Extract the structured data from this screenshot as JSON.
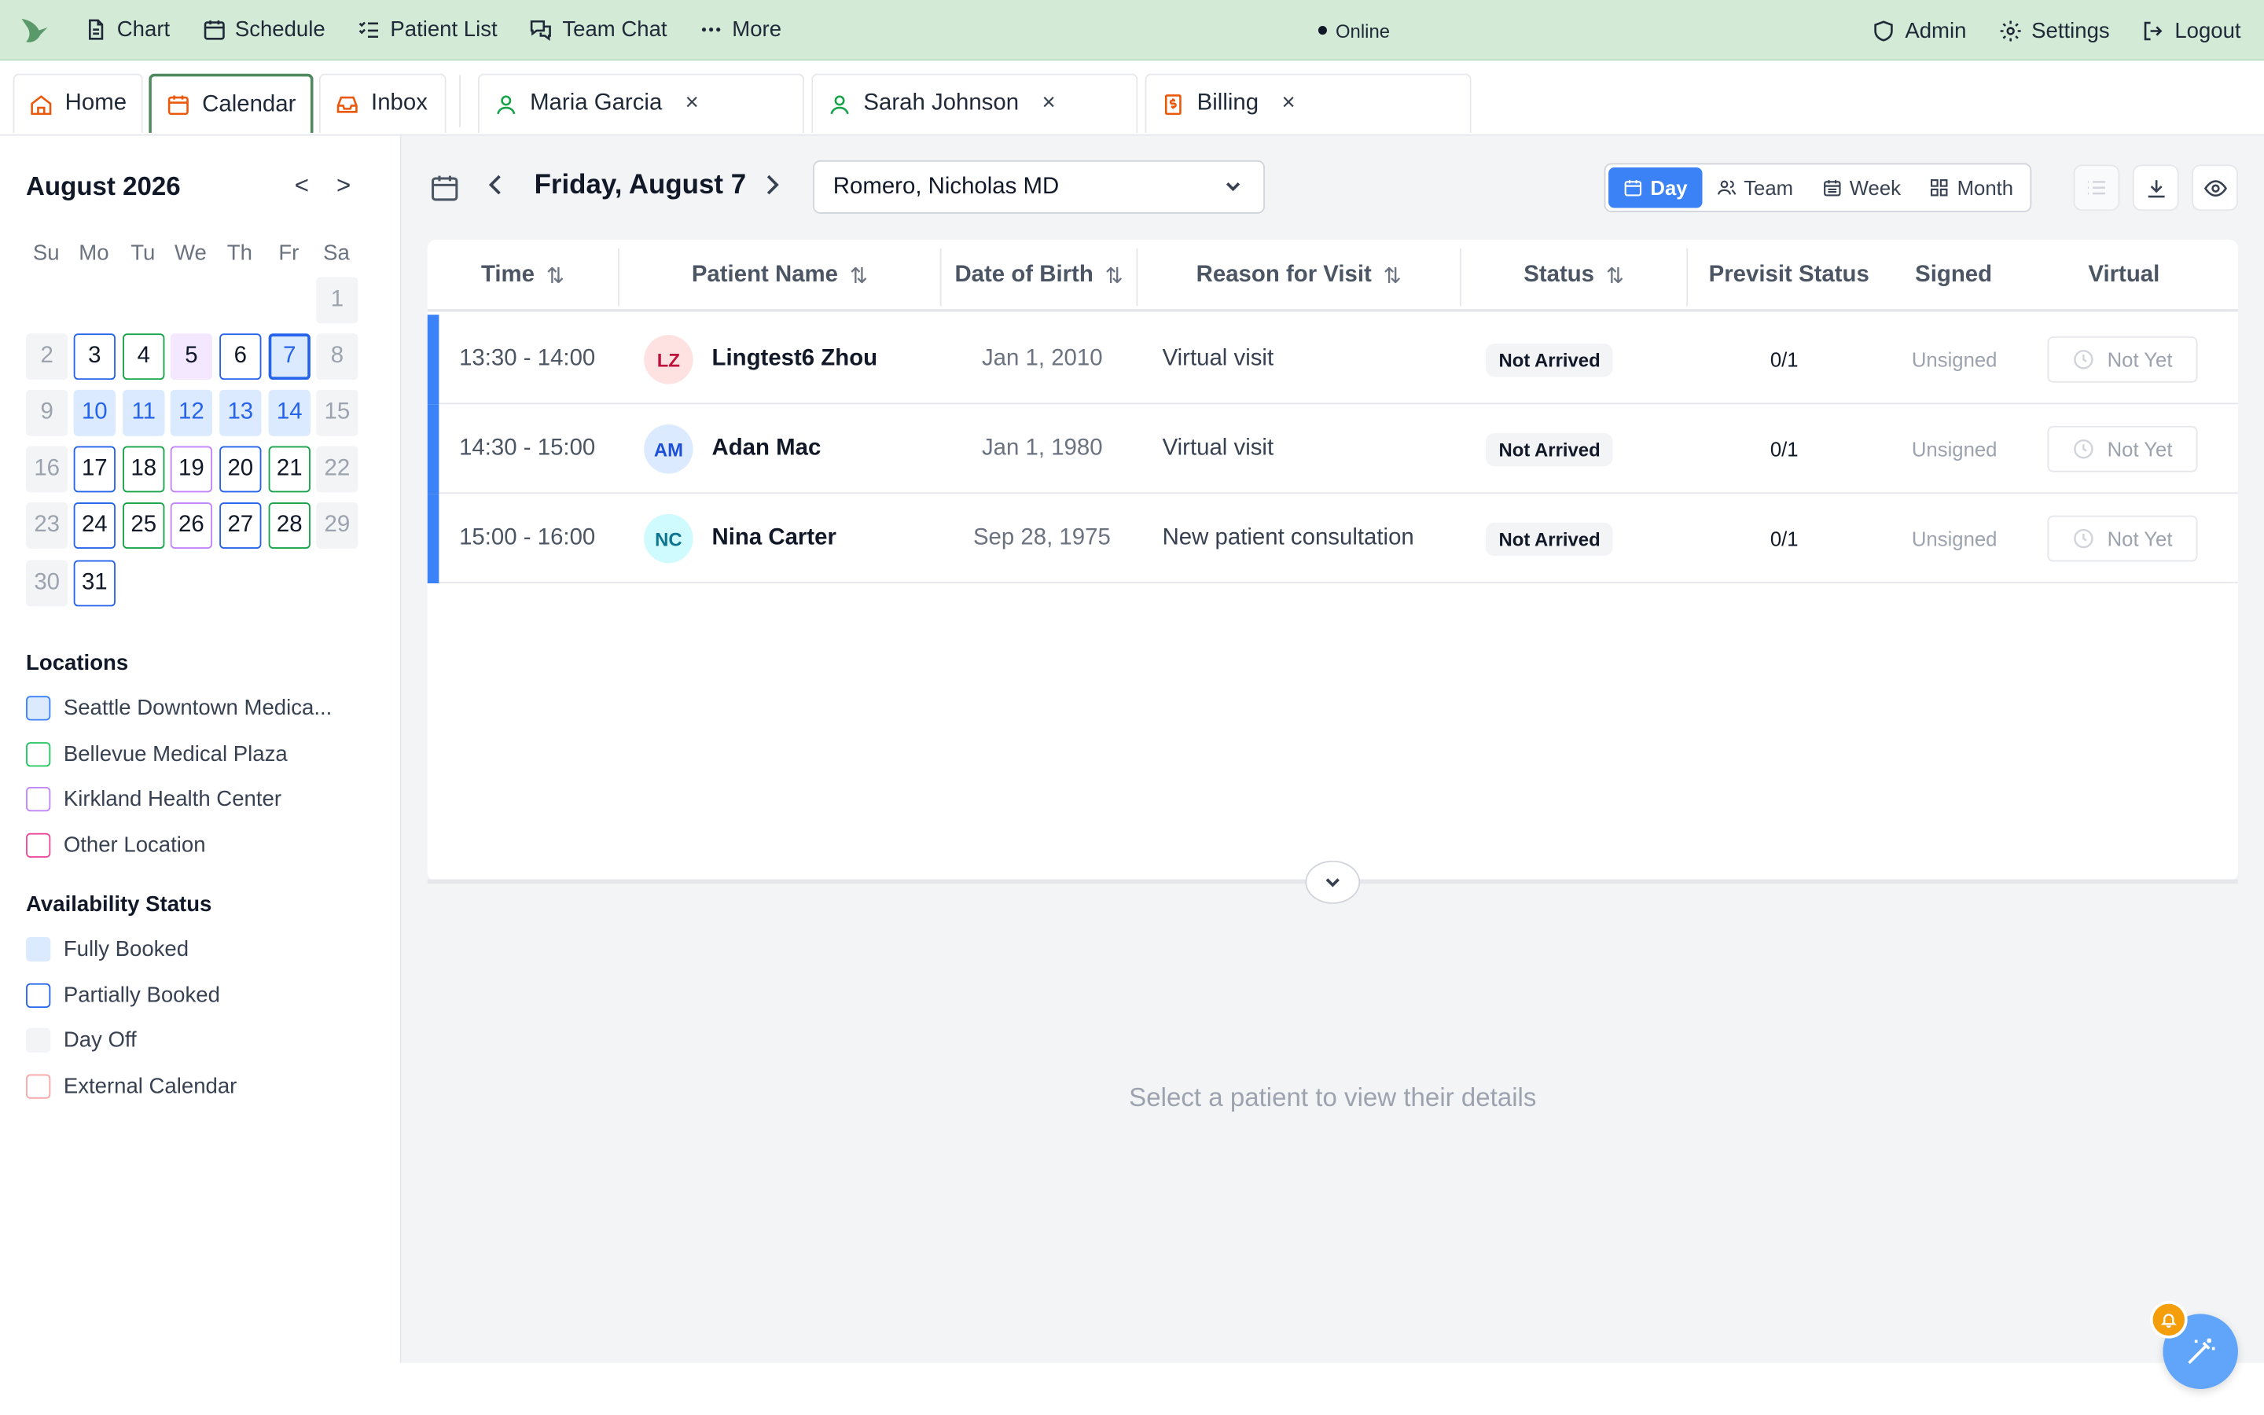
{
  "topnav": {
    "logo_icon": "bird-logo-icon",
    "items": [
      {
        "label": "Chart",
        "icon": "document-icon"
      },
      {
        "label": "Schedule",
        "icon": "calendar-icon"
      },
      {
        "label": "Patient List",
        "icon": "list-check-icon"
      },
      {
        "label": "Team Chat",
        "icon": "chat-icon"
      },
      {
        "label": "More",
        "icon": "ellipsis-icon"
      }
    ],
    "status": "Online",
    "right_items": [
      {
        "label": "Admin",
        "icon": "shield-icon"
      },
      {
        "label": "Settings",
        "icon": "gear-icon"
      },
      {
        "label": "Logout",
        "icon": "logout-icon"
      }
    ]
  },
  "tabs": {
    "home": "Home",
    "calendar": "Calendar",
    "inbox": "Inbox",
    "patient_tabs": [
      "Maria Garcia",
      "Sarah Johnson"
    ],
    "billing": "Billing",
    "close_symbol": "×"
  },
  "calendar": {
    "month_label": "August 2026",
    "prev": "<",
    "next": ">",
    "weekdays": [
      "Su",
      "Mo",
      "Tu",
      "We",
      "Th",
      "Fr",
      "Sa"
    ],
    "days": [
      {
        "n": 1,
        "col": 6,
        "row": 0,
        "state": "off"
      },
      {
        "n": 2,
        "col": 0,
        "row": 1,
        "state": "off"
      },
      {
        "n": 3,
        "col": 1,
        "row": 1,
        "state": "partial"
      },
      {
        "n": 4,
        "col": 2,
        "row": 1,
        "state": "green"
      },
      {
        "n": 5,
        "col": 3,
        "row": 1,
        "state": "lavender"
      },
      {
        "n": 6,
        "col": 4,
        "row": 1,
        "state": "partial"
      },
      {
        "n": 7,
        "col": 5,
        "row": 1,
        "state": "today"
      },
      {
        "n": 8,
        "col": 6,
        "row": 1,
        "state": "off"
      },
      {
        "n": 9,
        "col": 0,
        "row": 2,
        "state": "off"
      },
      {
        "n": 10,
        "col": 1,
        "row": 2,
        "state": "booked"
      },
      {
        "n": 11,
        "col": 2,
        "row": 2,
        "state": "booked"
      },
      {
        "n": 12,
        "col": 3,
        "row": 2,
        "state": "booked"
      },
      {
        "n": 13,
        "col": 4,
        "row": 2,
        "state": "booked"
      },
      {
        "n": 14,
        "col": 5,
        "row": 2,
        "state": "booked"
      },
      {
        "n": 15,
        "col": 6,
        "row": 2,
        "state": "off"
      },
      {
        "n": 16,
        "col": 0,
        "row": 3,
        "state": "off"
      },
      {
        "n": 17,
        "col": 1,
        "row": 3,
        "state": "partial"
      },
      {
        "n": 18,
        "col": 2,
        "row": 3,
        "state": "green"
      },
      {
        "n": 19,
        "col": 3,
        "row": 3,
        "state": "purple"
      },
      {
        "n": 20,
        "col": 4,
        "row": 3,
        "state": "partial"
      },
      {
        "n": 21,
        "col": 5,
        "row": 3,
        "state": "green"
      },
      {
        "n": 22,
        "col": 6,
        "row": 3,
        "state": "off"
      },
      {
        "n": 23,
        "col": 0,
        "row": 4,
        "state": "off"
      },
      {
        "n": 24,
        "col": 1,
        "row": 4,
        "state": "partial"
      },
      {
        "n": 25,
        "col": 2,
        "row": 4,
        "state": "green"
      },
      {
        "n": 26,
        "col": 3,
        "row": 4,
        "state": "purple"
      },
      {
        "n": 27,
        "col": 4,
        "row": 4,
        "state": "partial"
      },
      {
        "n": 28,
        "col": 5,
        "row": 4,
        "state": "green"
      },
      {
        "n": 29,
        "col": 6,
        "row": 4,
        "state": "off"
      },
      {
        "n": 30,
        "col": 0,
        "row": 5,
        "state": "off"
      },
      {
        "n": 31,
        "col": 1,
        "row": 5,
        "state": "partial"
      }
    ]
  },
  "locations": {
    "title": "Locations",
    "items": [
      {
        "label": "Seattle Downtown Medica...",
        "color": "#3b82f6",
        "fill": "#dbeafe"
      },
      {
        "label": "Bellevue Medical Plaza",
        "color": "#22c55e",
        "fill": "#ffffff"
      },
      {
        "label": "Kirkland Health Center",
        "color": "#c084fc",
        "fill": "#ffffff"
      },
      {
        "label": "Other Location",
        "color": "#ec4899",
        "fill": "#ffffff"
      }
    ]
  },
  "availability": {
    "title": "Availability Status",
    "items": [
      {
        "label": "Fully Booked",
        "color": "#dbeafe",
        "fill": "#dbeafe"
      },
      {
        "label": "Partially Booked",
        "color": "#2563eb",
        "fill": "#ffffff"
      },
      {
        "label": "Day Off",
        "color": "#f3f4f6",
        "fill": "#f3f4f6"
      },
      {
        "label": "External Calendar",
        "color": "#fca5a5",
        "fill": "#ffffff"
      }
    ]
  },
  "schedule": {
    "date_label": "Friday, August 7",
    "provider": "Romero, Nicholas MD",
    "views": [
      "Day",
      "Team",
      "Week",
      "Month"
    ],
    "active_view": "Day",
    "columns": {
      "time": "Time",
      "patient": "Patient Name",
      "dob": "Date of Birth",
      "reason": "Reason for Visit",
      "status": "Status",
      "previsit": "Previsit Status",
      "signed": "Signed",
      "virtual": "Virtual"
    },
    "sort_symbol": "⇅",
    "rows": [
      {
        "time": "13:30 - 14:00",
        "initials": "LZ",
        "avatar_bg": "#fee2e2",
        "avatar_fg": "#be123c",
        "name": "Lingtest6 Zhou",
        "dob": "Jan 1, 2010",
        "reason": "Virtual visit",
        "status": "Not Arrived",
        "previsit": "0/1",
        "signed": "Unsigned",
        "virtual": "Not Yet"
      },
      {
        "time": "14:30 - 15:00",
        "initials": "AM",
        "avatar_bg": "#dbeafe",
        "avatar_fg": "#1d4ed8",
        "name": "Adan Mac",
        "dob": "Jan 1, 1980",
        "reason": "Virtual visit",
        "status": "Not Arrived",
        "previsit": "0/1",
        "signed": "Unsigned",
        "virtual": "Not Yet"
      },
      {
        "time": "15:00 - 16:00",
        "initials": "NC",
        "avatar_bg": "#cffafe",
        "avatar_fg": "#0e7490",
        "name": "Nina Carter",
        "dob": "Sep 28, 1975",
        "reason": "New patient consultation",
        "status": "Not Arrived",
        "previsit": "0/1",
        "signed": "Unsigned",
        "virtual": "Not Yet"
      }
    ],
    "empty_detail": "Select a patient to view their details"
  },
  "colors": {
    "accent_blue": "#3b82f6",
    "nav_green": "#d3ead7",
    "tab_orange": "#ea580c",
    "patient_green": "#16a34a"
  }
}
